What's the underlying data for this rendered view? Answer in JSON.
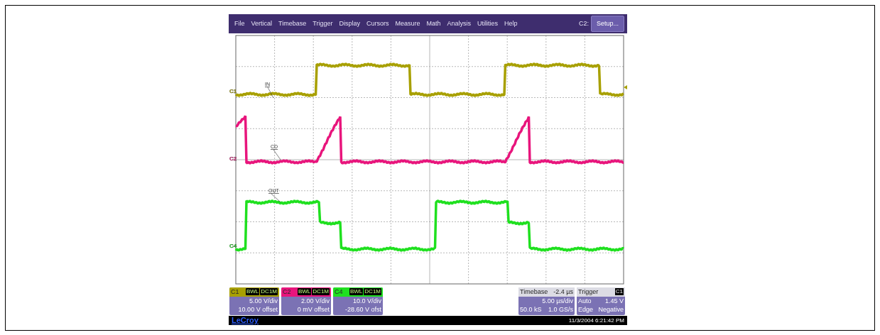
{
  "menu": [
    "File",
    "Vertical",
    "Timebase",
    "Trigger",
    "Display",
    "Cursors",
    "Measure",
    "Math",
    "Analysis",
    "Utilities",
    "Help"
  ],
  "active_channel": "C2:",
  "setup_button": "Setup...",
  "traces": [
    {
      "label": "IN",
      "channel": "C1",
      "color": "#a8a000"
    },
    {
      "label": "CD",
      "channel": "C2",
      "color": "#e8157c"
    },
    {
      "label": "OUT",
      "channel": "C4",
      "color": "#1fe01f"
    }
  ],
  "channel_boxes": [
    {
      "name": "C1",
      "badges": [
        "BWL",
        "DC1M"
      ],
      "scale": "5.00 V/div",
      "offset": "10.00 V offset",
      "color": "#a8a000"
    },
    {
      "name": "C2",
      "badges": [
        "BWL",
        "DC1M"
      ],
      "scale": "2.00 V/div",
      "offset": "0 mV offset",
      "color": "#e8157c"
    },
    {
      "name": "C4",
      "badges": [
        "BWL",
        "DC1M"
      ],
      "scale": "10.0 V/div",
      "offset": "-28.60 V ofst",
      "color": "#1fe01f"
    }
  ],
  "timebase": {
    "title": "Timebase",
    "delay": "-2.4 µs",
    "scale": "5.00 µs/div",
    "samples": "50.0 kS",
    "rate": "1.0 GS/s"
  },
  "trigger": {
    "title": "Trigger",
    "source": "C1",
    "mode": "Auto",
    "level": "1.45 V",
    "type": "Edge",
    "slope": "Negative"
  },
  "footer": {
    "brand": "LeCroy",
    "timestamp": "11/3/2004 6:21:42 PM"
  }
}
